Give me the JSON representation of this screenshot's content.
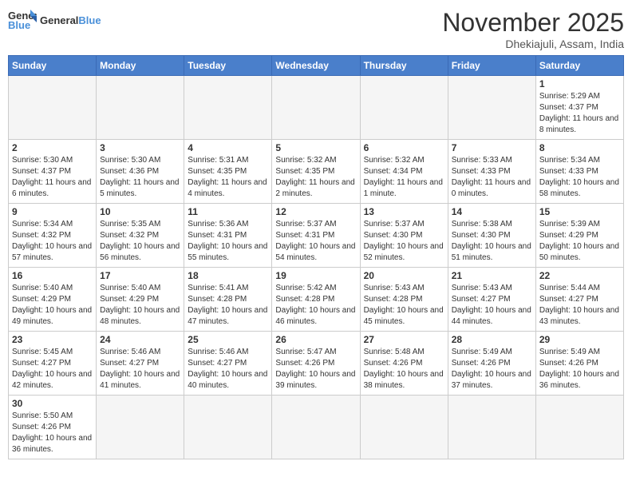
{
  "header": {
    "logo_general": "General",
    "logo_blue": "Blue",
    "month_title": "November 2025",
    "subtitle": "Dhekiajuli, Assam, India"
  },
  "days_of_week": [
    "Sunday",
    "Monday",
    "Tuesday",
    "Wednesday",
    "Thursday",
    "Friday",
    "Saturday"
  ],
  "weeks": [
    [
      {
        "day": "",
        "info": ""
      },
      {
        "day": "",
        "info": ""
      },
      {
        "day": "",
        "info": ""
      },
      {
        "day": "",
        "info": ""
      },
      {
        "day": "",
        "info": ""
      },
      {
        "day": "",
        "info": ""
      },
      {
        "day": "1",
        "info": "Sunrise: 5:29 AM\nSunset: 4:37 PM\nDaylight: 11 hours and 8 minutes."
      }
    ],
    [
      {
        "day": "2",
        "info": "Sunrise: 5:30 AM\nSunset: 4:37 PM\nDaylight: 11 hours and 6 minutes."
      },
      {
        "day": "3",
        "info": "Sunrise: 5:30 AM\nSunset: 4:36 PM\nDaylight: 11 hours and 5 minutes."
      },
      {
        "day": "4",
        "info": "Sunrise: 5:31 AM\nSunset: 4:35 PM\nDaylight: 11 hours and 4 minutes."
      },
      {
        "day": "5",
        "info": "Sunrise: 5:32 AM\nSunset: 4:35 PM\nDaylight: 11 hours and 2 minutes."
      },
      {
        "day": "6",
        "info": "Sunrise: 5:32 AM\nSunset: 4:34 PM\nDaylight: 11 hours and 1 minute."
      },
      {
        "day": "7",
        "info": "Sunrise: 5:33 AM\nSunset: 4:33 PM\nDaylight: 11 hours and 0 minutes."
      },
      {
        "day": "8",
        "info": "Sunrise: 5:34 AM\nSunset: 4:33 PM\nDaylight: 10 hours and 58 minutes."
      }
    ],
    [
      {
        "day": "9",
        "info": "Sunrise: 5:34 AM\nSunset: 4:32 PM\nDaylight: 10 hours and 57 minutes."
      },
      {
        "day": "10",
        "info": "Sunrise: 5:35 AM\nSunset: 4:32 PM\nDaylight: 10 hours and 56 minutes."
      },
      {
        "day": "11",
        "info": "Sunrise: 5:36 AM\nSunset: 4:31 PM\nDaylight: 10 hours and 55 minutes."
      },
      {
        "day": "12",
        "info": "Sunrise: 5:37 AM\nSunset: 4:31 PM\nDaylight: 10 hours and 54 minutes."
      },
      {
        "day": "13",
        "info": "Sunrise: 5:37 AM\nSunset: 4:30 PM\nDaylight: 10 hours and 52 minutes."
      },
      {
        "day": "14",
        "info": "Sunrise: 5:38 AM\nSunset: 4:30 PM\nDaylight: 10 hours and 51 minutes."
      },
      {
        "day": "15",
        "info": "Sunrise: 5:39 AM\nSunset: 4:29 PM\nDaylight: 10 hours and 50 minutes."
      }
    ],
    [
      {
        "day": "16",
        "info": "Sunrise: 5:40 AM\nSunset: 4:29 PM\nDaylight: 10 hours and 49 minutes."
      },
      {
        "day": "17",
        "info": "Sunrise: 5:40 AM\nSunset: 4:29 PM\nDaylight: 10 hours and 48 minutes."
      },
      {
        "day": "18",
        "info": "Sunrise: 5:41 AM\nSunset: 4:28 PM\nDaylight: 10 hours and 47 minutes."
      },
      {
        "day": "19",
        "info": "Sunrise: 5:42 AM\nSunset: 4:28 PM\nDaylight: 10 hours and 46 minutes."
      },
      {
        "day": "20",
        "info": "Sunrise: 5:43 AM\nSunset: 4:28 PM\nDaylight: 10 hours and 45 minutes."
      },
      {
        "day": "21",
        "info": "Sunrise: 5:43 AM\nSunset: 4:27 PM\nDaylight: 10 hours and 44 minutes."
      },
      {
        "day": "22",
        "info": "Sunrise: 5:44 AM\nSunset: 4:27 PM\nDaylight: 10 hours and 43 minutes."
      }
    ],
    [
      {
        "day": "23",
        "info": "Sunrise: 5:45 AM\nSunset: 4:27 PM\nDaylight: 10 hours and 42 minutes."
      },
      {
        "day": "24",
        "info": "Sunrise: 5:46 AM\nSunset: 4:27 PM\nDaylight: 10 hours and 41 minutes."
      },
      {
        "day": "25",
        "info": "Sunrise: 5:46 AM\nSunset: 4:27 PM\nDaylight: 10 hours and 40 minutes."
      },
      {
        "day": "26",
        "info": "Sunrise: 5:47 AM\nSunset: 4:26 PM\nDaylight: 10 hours and 39 minutes."
      },
      {
        "day": "27",
        "info": "Sunrise: 5:48 AM\nSunset: 4:26 PM\nDaylight: 10 hours and 38 minutes."
      },
      {
        "day": "28",
        "info": "Sunrise: 5:49 AM\nSunset: 4:26 PM\nDaylight: 10 hours and 37 minutes."
      },
      {
        "day": "29",
        "info": "Sunrise: 5:49 AM\nSunset: 4:26 PM\nDaylight: 10 hours and 36 minutes."
      }
    ],
    [
      {
        "day": "30",
        "info": "Sunrise: 5:50 AM\nSunset: 4:26 PM\nDaylight: 10 hours and 36 minutes."
      },
      {
        "day": "",
        "info": ""
      },
      {
        "day": "",
        "info": ""
      },
      {
        "day": "",
        "info": ""
      },
      {
        "day": "",
        "info": ""
      },
      {
        "day": "",
        "info": ""
      },
      {
        "day": "",
        "info": ""
      }
    ]
  ]
}
